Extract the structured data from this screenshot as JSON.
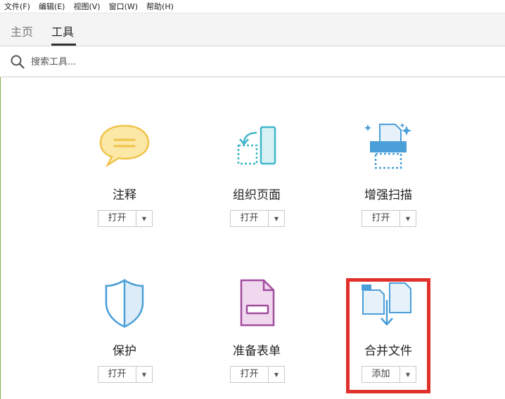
{
  "menu": [
    "文件(F)",
    "编辑(E)",
    "视图(V)",
    "窗口(W)",
    "帮助(H)"
  ],
  "tabs": [
    {
      "label": "主页",
      "active": false
    },
    {
      "label": "工具",
      "active": true
    }
  ],
  "search": {
    "placeholder": "搜索工具...",
    "icon": "search-icon"
  },
  "tools": [
    {
      "label": "注释",
      "button": "打开",
      "icon": "comment-icon"
    },
    {
      "label": "组织页面",
      "button": "打开",
      "icon": "organize-pages-icon"
    },
    {
      "label": "增强扫描",
      "button": "打开",
      "icon": "enhance-scan-icon"
    },
    {
      "label": "保护",
      "button": "打开",
      "icon": "shield-icon"
    },
    {
      "label": "准备表单",
      "button": "打开",
      "icon": "prepare-form-icon"
    },
    {
      "label": "合并文件",
      "button": "添加",
      "icon": "combine-files-icon",
      "highlighted": true
    }
  ],
  "colors": {
    "highlight": "#e0302b",
    "accent_blue": "#4a9fd8",
    "comment_yellow": "#f3c94f",
    "form_purple": "#a24c9e",
    "organize_teal": "#3fb6c9"
  }
}
